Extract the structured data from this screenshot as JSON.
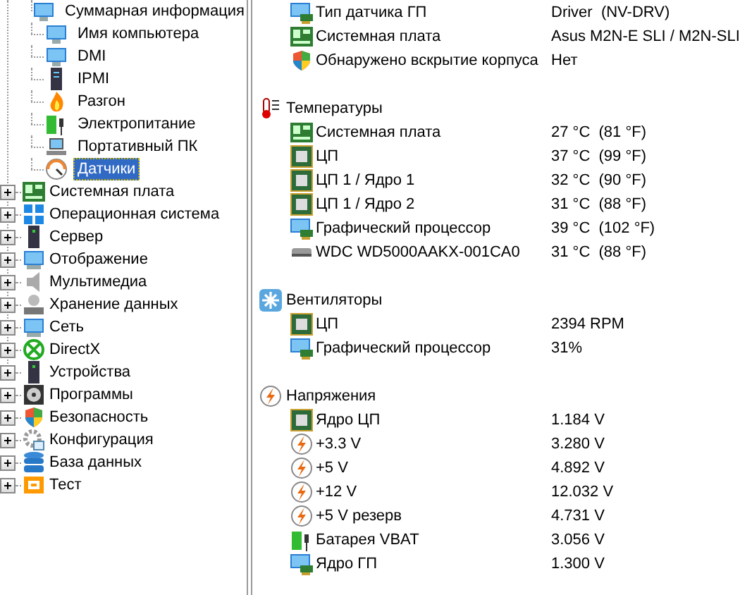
{
  "tree": {
    "children": [
      {
        "label": "Суммарная информация",
        "kind": "monitor",
        "selected": false
      },
      {
        "label": "Имя компьютера",
        "kind": "monitor",
        "selected": false
      },
      {
        "label": "DMI",
        "kind": "monitor",
        "selected": false
      },
      {
        "label": "IPMI",
        "kind": "server",
        "selected": false
      },
      {
        "label": "Разгон",
        "kind": "flame",
        "selected": false
      },
      {
        "label": "Электропитание",
        "kind": "battery",
        "selected": false
      },
      {
        "label": "Портативный ПК",
        "kind": "laptop",
        "selected": false
      },
      {
        "label": "Датчики",
        "kind": "gauge",
        "selected": true
      }
    ],
    "items": [
      {
        "label": "Системная плата",
        "kind": "board",
        "expanded": false
      },
      {
        "label": "Операционная система",
        "kind": "windows",
        "expanded": false
      },
      {
        "label": "Сервер",
        "kind": "server",
        "expanded": false
      },
      {
        "label": "Отображение",
        "kind": "monitor",
        "expanded": false
      },
      {
        "label": "Мультимедиа",
        "kind": "speaker",
        "expanded": false
      },
      {
        "label": "Хранение данных",
        "kind": "disk",
        "expanded": false
      },
      {
        "label": "Сеть",
        "kind": "network",
        "expanded": false
      },
      {
        "label": "DirectX",
        "kind": "xcircle",
        "expanded": false
      },
      {
        "label": "Устройства",
        "kind": "device",
        "expanded": false
      },
      {
        "label": "Программы",
        "kind": "programs",
        "expanded": false
      },
      {
        "label": "Безопасность",
        "kind": "shield",
        "expanded": false
      },
      {
        "label": "Конфигурация",
        "kind": "gear",
        "expanded": false
      },
      {
        "label": "База данных",
        "kind": "database",
        "expanded": false
      },
      {
        "label": "Тест",
        "kind": "test",
        "expanded": false
      }
    ]
  },
  "sections": [
    {
      "rows": [
        {
          "label": "Тип датчика ГП",
          "value": "Driver  (NV-DRV)",
          "kind": "gpu"
        },
        {
          "label": "Системная плата",
          "value": "Asus M2N-E SLI / M2N-SLI",
          "kind": "board"
        },
        {
          "label": "Обнаружено вскрытие корпуса",
          "value": "Нет",
          "kind": "shield"
        }
      ]
    },
    {
      "title": "Температуры",
      "kind": "thermo",
      "rows": [
        {
          "label": "Системная плата",
          "value": "27 °C  (81 °F)",
          "kind": "board"
        },
        {
          "label": "ЦП",
          "value": "37 °C  (99 °F)",
          "kind": "chip"
        },
        {
          "label": "ЦП 1 / Ядро 1",
          "value": "32 °C  (90 °F)",
          "kind": "chip"
        },
        {
          "label": "ЦП 1 / Ядро 2",
          "value": "31 °C  (88 °F)",
          "kind": "chip"
        },
        {
          "label": "Графический процессор",
          "value": "39 °C  (102 °F)",
          "kind": "gpu"
        },
        {
          "label": "WDC WD5000AAKX-001CA0",
          "value": "31 °C  (88 °F)",
          "kind": "drive"
        }
      ]
    },
    {
      "title": "Вентиляторы",
      "kind": "fan",
      "rows": [
        {
          "label": "ЦП",
          "value": "2394 RPM",
          "kind": "chip"
        },
        {
          "label": "Графический процессор",
          "value": "31%",
          "kind": "gpu"
        }
      ]
    },
    {
      "title": "Напряжения",
      "kind": "bolt",
      "rows": [
        {
          "label": "Ядро ЦП",
          "value": "1.184 V",
          "kind": "chip"
        },
        {
          "label": "+3.3 V",
          "value": "3.280 V",
          "kind": "bolt"
        },
        {
          "label": "+5 V",
          "value": "4.892 V",
          "kind": "bolt"
        },
        {
          "label": "+12 V",
          "value": "12.032 V",
          "kind": "bolt"
        },
        {
          "label": "+5 V резерв",
          "value": "4.731 V",
          "kind": "bolt"
        },
        {
          "label": "Батарея VBAT",
          "value": "3.056 V",
          "kind": "battery"
        },
        {
          "label": "Ядро ГП",
          "value": "1.300 V",
          "kind": "gpu"
        }
      ]
    }
  ]
}
